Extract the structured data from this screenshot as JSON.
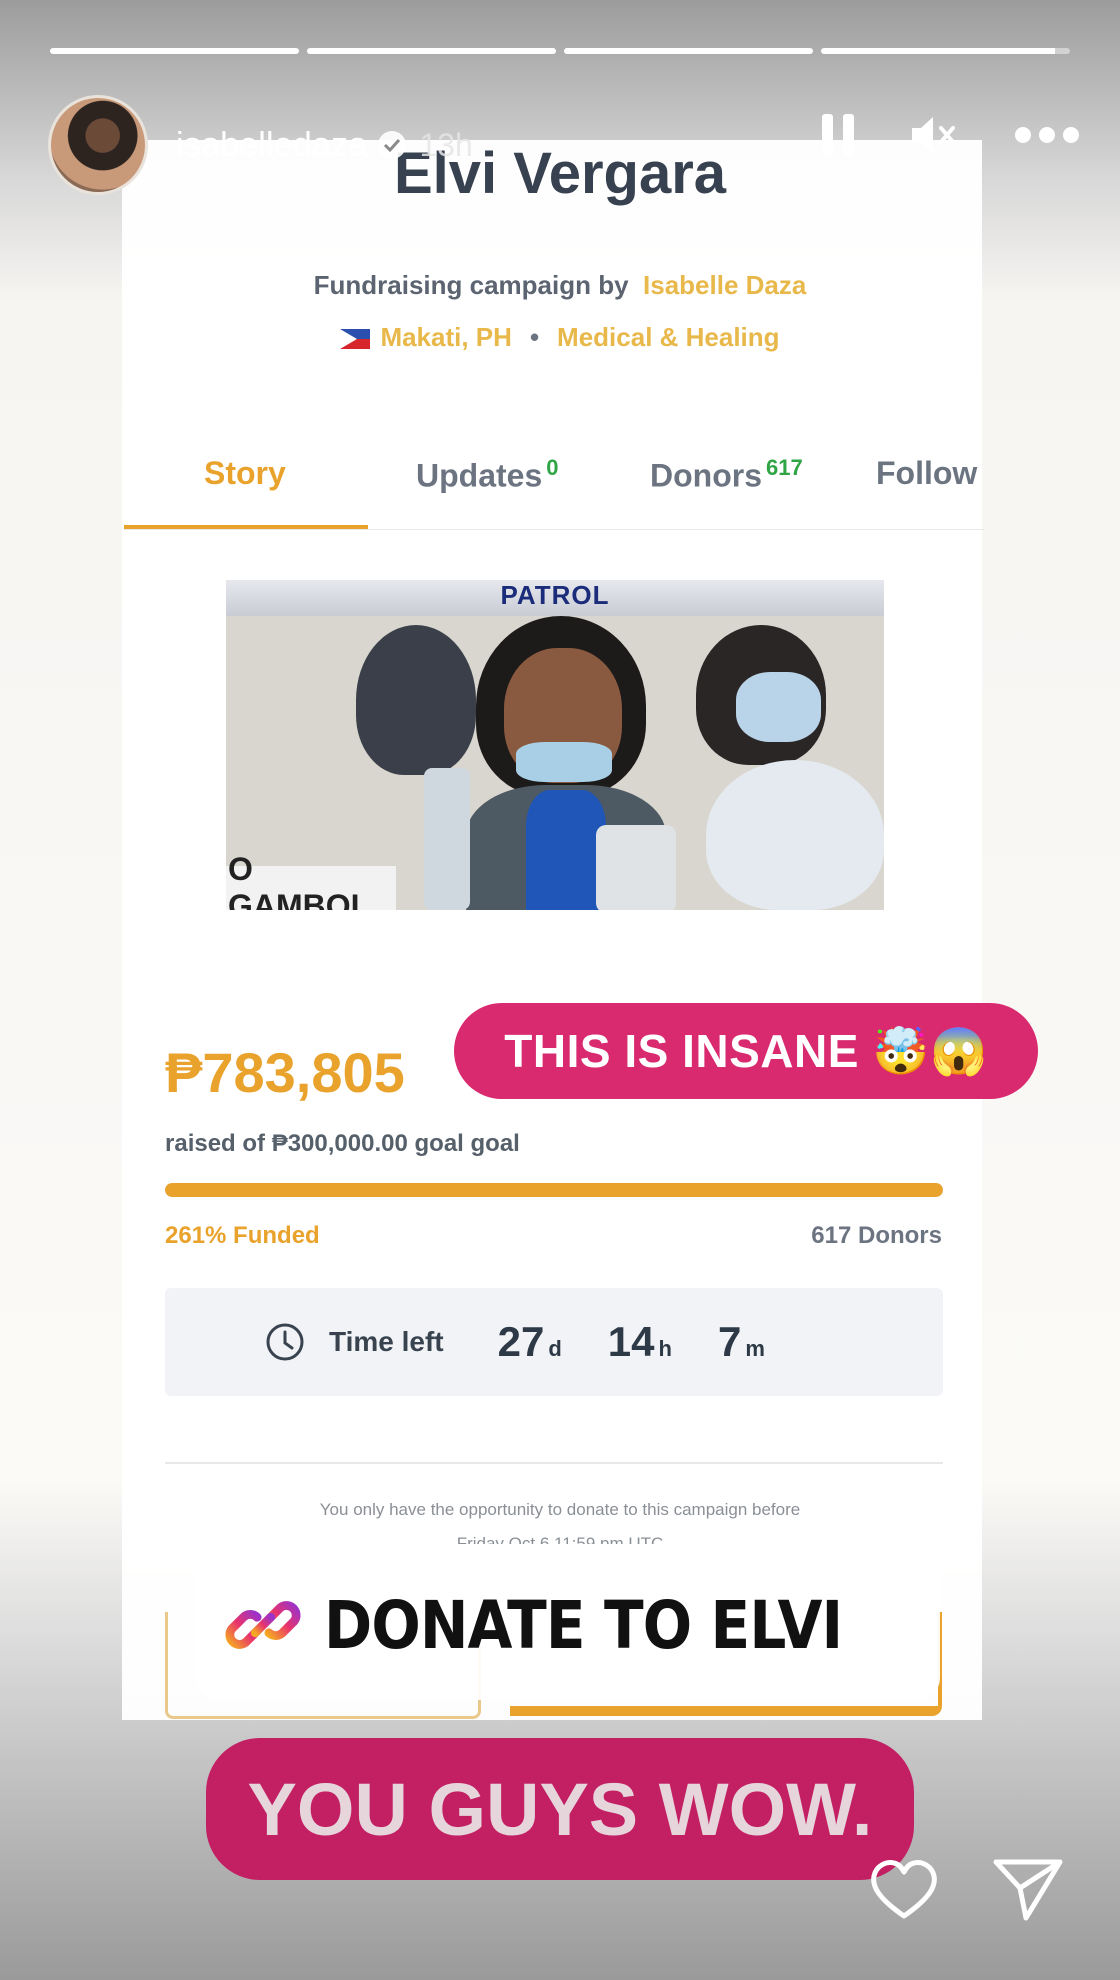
{
  "story": {
    "username": "isabelledaza",
    "age": "13h"
  },
  "campaign": {
    "title": "Elvi Vergara",
    "byline_prefix": "Fundraising campaign by",
    "organizer": "Isabelle Daza",
    "location": "Makati, PH",
    "category": "Medical & Healing"
  },
  "tabs": [
    {
      "label": "Story",
      "count": ""
    },
    {
      "label": "Updates",
      "count": "0"
    },
    {
      "label": "Donors",
      "count": "617"
    },
    {
      "label": "Follow",
      "count": ""
    }
  ],
  "photo": {
    "banner": "PATROL",
    "placard": "O GAMBOL"
  },
  "stats": {
    "raised": "₱783,805",
    "goal_text": "raised of ₱300,000.00 goal goal",
    "progress_percent": 100,
    "funded": "261% Funded",
    "donors": "617 Donors"
  },
  "time_left": {
    "label": "Time left",
    "days": "27",
    "days_unit": "d",
    "hours": "14",
    "hours_unit": "h",
    "minutes": "7",
    "minutes_unit": "m"
  },
  "note": {
    "line1": "You only have the opportunity to donate to this campaign before",
    "line2": "Friday Oct 6 11:59 pm UTC"
  },
  "stickers": {
    "insane": "THIS IS INSANE 🤯😱",
    "link": "DONATE TO ELVI",
    "wow": "YOU GUYS WOW."
  },
  "colors": {
    "accent": "#e9a32c",
    "sticker_pink": "#d9296f",
    "sticker_magenta": "#c22063",
    "green_count": "#2fa545"
  },
  "icons": {
    "pause": "pause-icon",
    "mute": "mute-icon",
    "more": "more-icon",
    "verified": "verified-badge-icon",
    "clock": "clock-icon",
    "link": "link-icon",
    "heart": "heart-icon",
    "share": "send-icon"
  }
}
